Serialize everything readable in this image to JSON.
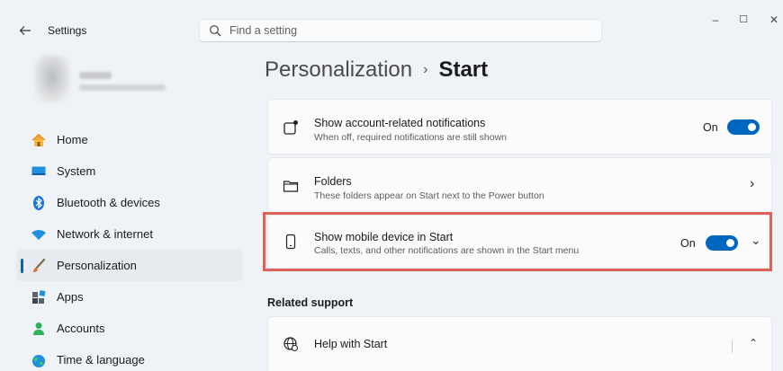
{
  "window": {
    "title": "Settings",
    "back_icon": "back-arrow-icon",
    "controls": {
      "minimize": "–",
      "maximize": "☐",
      "close": "✕"
    }
  },
  "search": {
    "placeholder": "Find a setting",
    "value": ""
  },
  "sidebar": {
    "items": [
      {
        "label": "Home",
        "icon": "home-icon",
        "active": false
      },
      {
        "label": "System",
        "icon": "system-icon",
        "active": false
      },
      {
        "label": "Bluetooth & devices",
        "icon": "bluetooth-icon",
        "active": false
      },
      {
        "label": "Network & internet",
        "icon": "network-icon",
        "active": false
      },
      {
        "label": "Personalization",
        "icon": "personalization-icon",
        "active": true
      },
      {
        "label": "Apps",
        "icon": "apps-icon",
        "active": false
      },
      {
        "label": "Accounts",
        "icon": "accounts-icon",
        "active": false
      },
      {
        "label": "Time & language",
        "icon": "time-language-icon",
        "active": false
      }
    ]
  },
  "breadcrumb": {
    "parent": "Personalization",
    "separator": "›",
    "current": "Start"
  },
  "settings": [
    {
      "title": "Show account-related notifications",
      "description": "When off, required notifications are still shown",
      "icon": "account-notification-icon",
      "toggle_label": "On",
      "toggle_on": true
    },
    {
      "title": "Folders",
      "description": "These folders appear on Start next to the Power button",
      "icon": "folder-icon",
      "chevron": "›"
    },
    {
      "title": "Show mobile device in Start",
      "description": "Calls, texts, and other notifications are shown in the Start menu",
      "icon": "mobile-device-icon",
      "toggle_label": "On",
      "toggle_on": true,
      "chevron": "⌄",
      "highlighted": true
    }
  ],
  "related_support": {
    "heading": "Related support",
    "items": [
      {
        "title": "Help with Start",
        "icon": "globe-help-icon",
        "chevron": "⌃"
      }
    ]
  },
  "colors": {
    "accent": "#0067c0",
    "highlight": "#e0605a",
    "background": "#eff2f7",
    "card": "#fbfbfc"
  }
}
